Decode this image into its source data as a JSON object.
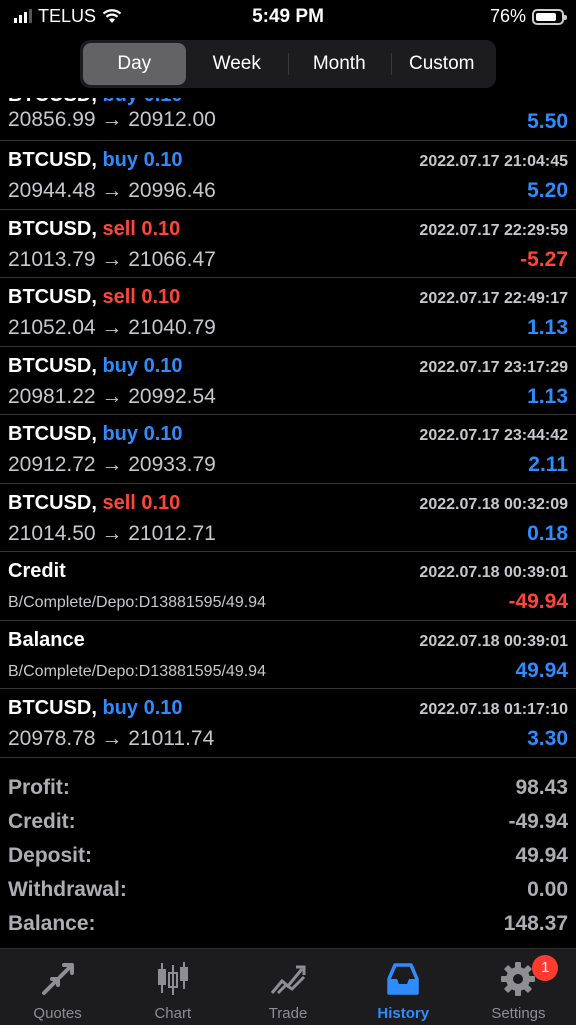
{
  "status_bar": {
    "carrier": "TELUS",
    "time": "5:49 PM",
    "battery": "76%"
  },
  "period_tabs": [
    {
      "label": "Day",
      "active": true
    },
    {
      "label": "Week",
      "active": false
    },
    {
      "label": "Month",
      "active": false
    },
    {
      "label": "Custom",
      "active": false
    }
  ],
  "partial_row": {
    "price": "20856.99 → 20912.00",
    "profit": "5.50"
  },
  "rows": [
    {
      "symbol": "BTCUSD,",
      "side": "buy 0.10",
      "side_class": "buy",
      "time": "2022.07.17 21:04:45",
      "detail": "20944.48 → 20996.46",
      "profit": "5.20",
      "profit_class": "pos"
    },
    {
      "symbol": "BTCUSD,",
      "side": "sell 0.10",
      "side_class": "sell",
      "time": "2022.07.17 22:29:59",
      "detail": "21013.79 → 21066.47",
      "profit": "-5.27",
      "profit_class": "neg"
    },
    {
      "symbol": "BTCUSD,",
      "side": "sell 0.10",
      "side_class": "sell",
      "time": "2022.07.17 22:49:17",
      "detail": "21052.04 → 21040.79",
      "profit": "1.13",
      "profit_class": "pos"
    },
    {
      "symbol": "BTCUSD,",
      "side": "buy 0.10",
      "side_class": "buy",
      "time": "2022.07.17 23:17:29",
      "detail": "20981.22 → 20992.54",
      "profit": "1.13",
      "profit_class": "pos"
    },
    {
      "symbol": "BTCUSD,",
      "side": "buy 0.10",
      "side_class": "buy",
      "time": "2022.07.17 23:44:42",
      "detail": "20912.72 → 20933.79",
      "profit": "2.11",
      "profit_class": "pos"
    },
    {
      "symbol": "BTCUSD,",
      "side": "sell 0.10",
      "side_class": "sell",
      "time": "2022.07.18 00:32:09",
      "detail": "21014.50 → 21012.71",
      "profit": "0.18",
      "profit_class": "pos"
    },
    {
      "symbol": "Credit",
      "side": "",
      "side_class": "",
      "time": "2022.07.18 00:39:01",
      "comment": "B/Complete/Depo:D13881595/49.94",
      "profit": "-49.94",
      "profit_class": "neg"
    },
    {
      "symbol": "Balance",
      "side": "",
      "side_class": "",
      "time": "2022.07.18 00:39:01",
      "comment": "B/Complete/Depo:D13881595/49.94",
      "profit": "49.94",
      "profit_class": "pos"
    },
    {
      "symbol": "BTCUSD,",
      "side": "buy 0.10",
      "side_class": "buy",
      "time": "2022.07.18 01:17:10",
      "detail": "20978.78 → 21011.74",
      "profit": "3.30",
      "profit_class": "pos"
    }
  ],
  "summary": [
    {
      "label": "Profit:",
      "value": "98.43"
    },
    {
      "label": "Credit:",
      "value": "-49.94"
    },
    {
      "label": "Deposit:",
      "value": "49.94"
    },
    {
      "label": "Withdrawal:",
      "value": "0.00"
    },
    {
      "label": "Balance:",
      "value": "148.37"
    }
  ],
  "tab_bar": [
    {
      "label": "Quotes",
      "icon": "quotes-icon",
      "active": false
    },
    {
      "label": "Chart",
      "icon": "chart-icon",
      "active": false
    },
    {
      "label": "Trade",
      "icon": "trade-icon",
      "active": false
    },
    {
      "label": "History",
      "icon": "history-icon",
      "active": true
    },
    {
      "label": "Settings",
      "icon": "settings-icon",
      "active": false,
      "badge": "1"
    }
  ],
  "colors": {
    "accent": "#2f8cff",
    "negative": "#ff453a",
    "background": "#000000"
  }
}
